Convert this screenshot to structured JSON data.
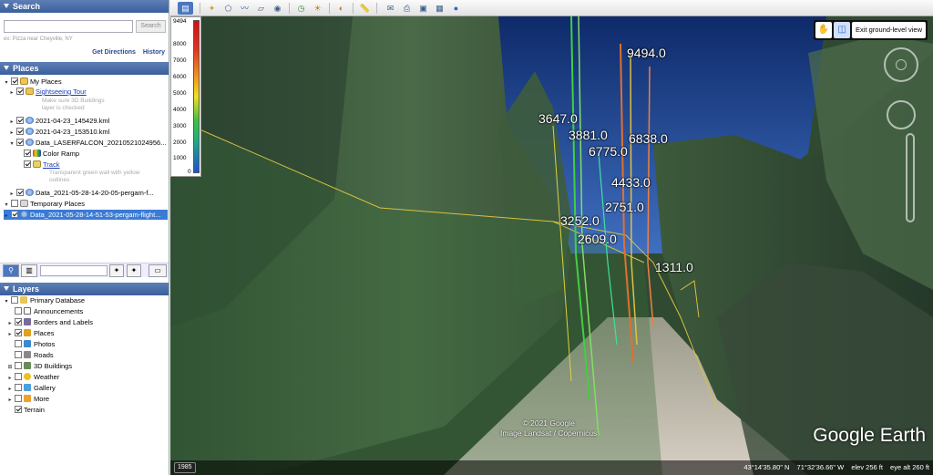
{
  "search": {
    "title": "Search",
    "placeholder": "",
    "button": "Search",
    "hint": "ex: Pizza near Cheyville, NY",
    "get_directions": "Get Directions",
    "history": "History"
  },
  "places": {
    "title": "Places",
    "items": [
      {
        "label": "My Places"
      },
      {
        "label": "Sightseeing Tour",
        "desc": "Make sure 3D Buildings layer is checked"
      },
      {
        "label": "2021-04-23_145429.kml"
      },
      {
        "label": "2021-04-23_153510.kml"
      },
      {
        "label": "Data_LASERFALCON_20210521024956..."
      },
      {
        "label": "Color Ramp"
      },
      {
        "label": "Track",
        "desc": "Transparent green wall with yellow outlines"
      },
      {
        "label": "Data_2021-05-28-14-20-05-pergam-f..."
      },
      {
        "label": "Temporary Places"
      },
      {
        "label": "Data_2021-05-28-14-51-53-pergam-flight..."
      }
    ]
  },
  "layers": {
    "title": "Layers",
    "items": [
      {
        "label": "Primary Database"
      },
      {
        "label": "Announcements"
      },
      {
        "label": "Borders and Labels"
      },
      {
        "label": "Places"
      },
      {
        "label": "Photos"
      },
      {
        "label": "Roads"
      },
      {
        "label": "3D Buildings"
      },
      {
        "label": "Weather"
      },
      {
        "label": "Gallery"
      },
      {
        "label": "More"
      },
      {
        "label": "Terrain"
      }
    ]
  },
  "legend": {
    "ticks": [
      "9494",
      "8000",
      "7000",
      "6000",
      "5000",
      "4000",
      "3000",
      "2000",
      "1000",
      "0"
    ]
  },
  "view": {
    "labels": [
      {
        "text": "9494.0"
      },
      {
        "text": "3647.0"
      },
      {
        "text": "3881.0"
      },
      {
        "text": "6838.0"
      },
      {
        "text": "6775.0"
      },
      {
        "text": "4433.0"
      },
      {
        "text": "2751.0"
      },
      {
        "text": "3252.0"
      },
      {
        "text": "2609.0"
      },
      {
        "text": "1311.0"
      }
    ],
    "exit_button": "Exit ground-level view",
    "copyright_line1": "© 2021 Google",
    "copyright_line2": "Image Landsat / Copernicus",
    "logo": "Google Earth"
  },
  "status": {
    "year": "1985",
    "lat": "43°14'35.80\" N",
    "lon": "71°32'36.66\" W",
    "elev": "elev  256 ft",
    "eye": "eye alt   260 ft"
  }
}
